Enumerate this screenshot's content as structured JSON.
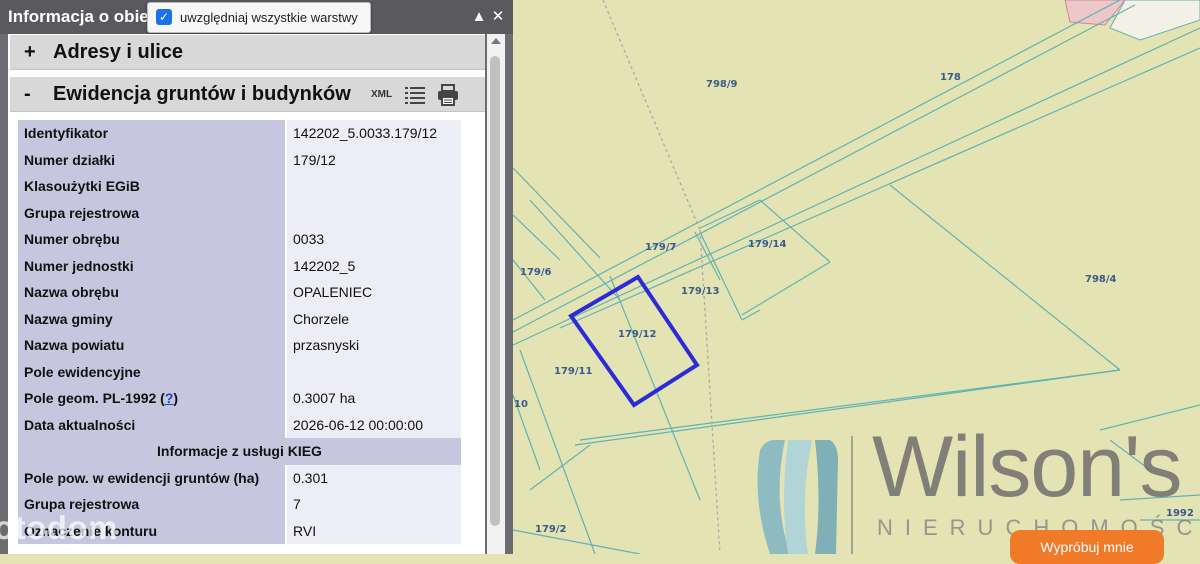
{
  "panel": {
    "title": "Informacja o obiekcie",
    "collapse_icon": "chevron-up-icon",
    "close_icon": "close-icon",
    "layers_checkbox": {
      "label": "uwzględniaj wszystkie warstwy",
      "checked": true
    }
  },
  "sections": [
    {
      "sign": "+",
      "title": "Adresy i ulice"
    },
    {
      "sign": "-",
      "title": "Ewidencja gruntów i budynków",
      "tools": [
        "XML",
        "list-icon",
        "printer-icon"
      ]
    }
  ],
  "xml_label": "XML",
  "attributes": [
    {
      "key": "Identyfikator",
      "value": "142202_5.0033.179/12"
    },
    {
      "key": "Numer działki",
      "value": "179/12"
    },
    {
      "key": "Klasoużytki EGiB",
      "value": ""
    },
    {
      "key": "Grupa rejestrowa",
      "value": ""
    },
    {
      "key": "Numer obrębu",
      "value": "0033"
    },
    {
      "key": "Numer jednostki",
      "value": "142202_5"
    },
    {
      "key": "Nazwa obrębu",
      "value": "OPALENIEC"
    },
    {
      "key": "Nazwa gminy",
      "value": "Chorzele"
    },
    {
      "key": "Nazwa powiatu",
      "value": "przasnyski"
    },
    {
      "key": "Pole ewidencyjne",
      "value": ""
    },
    {
      "key": "Pole geom. PL-1992 (",
      "link": "?",
      "suffix": ")",
      "value": "0.3007 ha"
    },
    {
      "key": "Data aktualności",
      "value": "2026-06-12 00:00:00"
    }
  ],
  "kieg_header": "Informacje z usługi KIEG",
  "kieg_attributes": [
    {
      "key": "Pole pow. w ewidencji gruntów (ha)",
      "value": "0.301"
    },
    {
      "key": "Grupa rejestrowa",
      "value": "7"
    },
    {
      "key": "Oznaczenie konturu",
      "value": "RVI"
    }
  ],
  "map": {
    "labels": [
      "798/9",
      "178",
      "179/7",
      "179/14",
      "179/6",
      "179/13",
      "798/4",
      "179/12",
      "179/11",
      "10",
      "179/2",
      "1992"
    ],
    "highlight_color": "#2b2bd8",
    "line_color": "#5fb3b3",
    "background": "#e4e3b4"
  },
  "watermark": {
    "otodom": "otodom",
    "brand": "Wilson's",
    "brand_sub": "NIERUCHOMOŚCI"
  },
  "try_button": "Wypróbuj mnie"
}
